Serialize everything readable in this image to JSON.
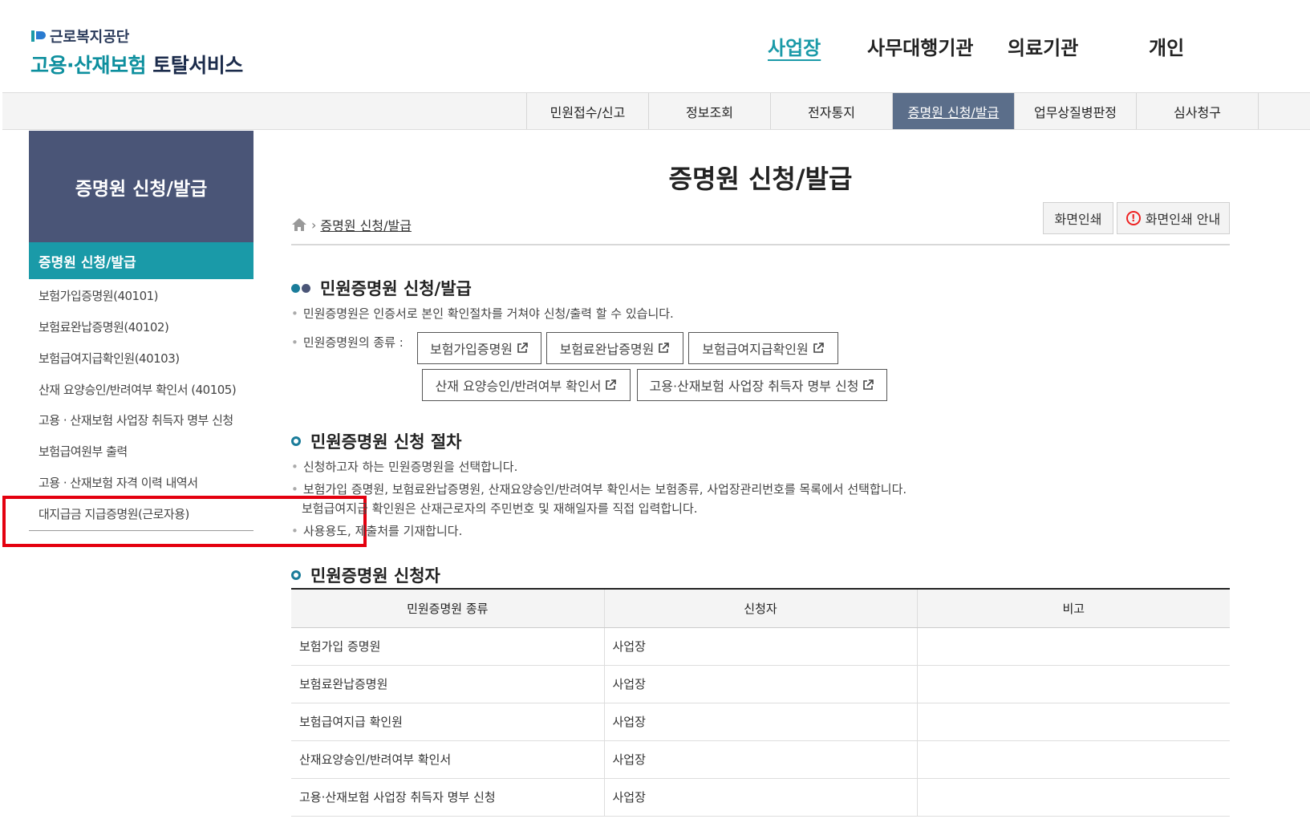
{
  "header": {
    "org_name": "근로복지공단",
    "service_name_part1": "고용·산재보험",
    "service_name_part2": "토탈서비스",
    "user_tabs": [
      "사업장",
      "사무대행기관",
      "의료기관",
      "개인"
    ],
    "active_user_tab": "사업장"
  },
  "gnb": {
    "items": [
      "민원접수/신고",
      "정보조회",
      "전자통지",
      "증명원 신청/발급",
      "업무상질병판정",
      "심사청구"
    ],
    "active": "증명원 신청/발급"
  },
  "sidebar": {
    "title": "증명원 신청/발급",
    "active_item": "증명원 신청/발급",
    "items": [
      "보험가입증명원(40101)",
      "보험료완납증명원(40102)",
      "보험급여지급확인원(40103)",
      "산재 요양승인/반려여부 확인서 (40105)",
      "고용 · 산재보험 사업장 취득자 명부 신청",
      "보험급여원부 출력",
      "고용 · 산재보험 자격 이력 내역서",
      "대지급금 지급증명원(근로자용)"
    ]
  },
  "main": {
    "title": "증명원 신청/발급",
    "breadcrumb": "증명원 신청/발급",
    "print_button": "화면인쇄",
    "print_guide_button": "화면인쇄 안내",
    "section1": {
      "title": "민원증명원 신청/발급",
      "desc": "민원증명원은 인증서로 본인 확인절차를 거쳐야 신청/출력 할 수 있습니다.",
      "types_label": "민원증명원의 종류 :",
      "links": [
        "보험가입증명원",
        "보험료완납증명원",
        "보험급여지급확인원",
        "산재 요양승인/반려여부 확인서",
        "고용·산재보험 사업장 취득자 명부 신청"
      ]
    },
    "section2": {
      "title": "민원증명원 신청 절차",
      "steps": [
        "신청하고자 하는 민원증명원을 선택합니다.",
        "보험가입 증명원, 보험료완납증명원, 산재요양승인/반려여부 확인서는 보험종류, 사업장관리번호를 목록에서 선택합니다.",
        "보험급여지급 확인원은 산재근로자의 주민번호 및 재해일자를 직접 입력합니다.",
        "사용용도, 제출처를 기재합니다."
      ]
    },
    "section3": {
      "title": "민원증명원 신청자",
      "columns": [
        "민원증명원 종류",
        "신청자",
        "비고"
      ],
      "rows": [
        [
          "보험가입 증명원",
          "사업장",
          ""
        ],
        [
          "보험료완납증명원",
          "사업장",
          ""
        ],
        [
          "보험급여지급 확인원",
          "사업장",
          ""
        ],
        [
          "산재요양승인/반려여부 확인서",
          "사업장",
          ""
        ],
        [
          "고용·산재보험 사업장 취득자 명부 신청",
          "사업장",
          ""
        ]
      ]
    }
  },
  "colors": {
    "accent_teal": "#1a9aa8",
    "sidebar_navy": "#4a5577",
    "gnb_active": "#5b6e8a",
    "highlight_red": "#e4000f"
  }
}
